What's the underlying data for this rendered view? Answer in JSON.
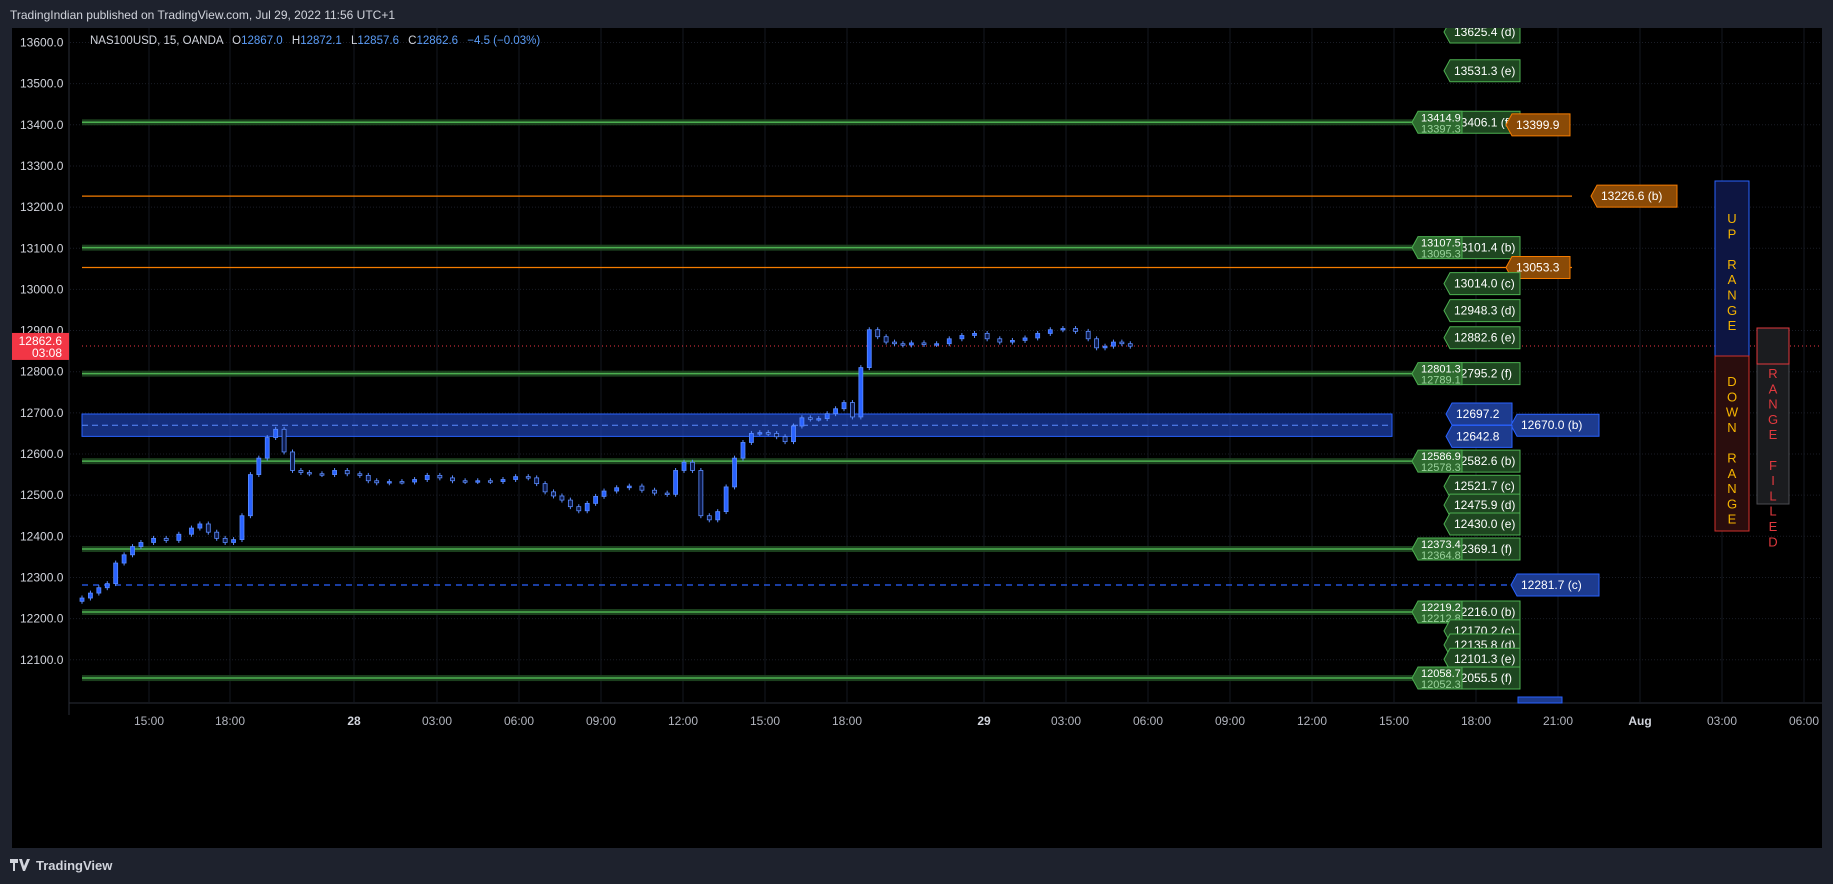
{
  "header": {
    "publisher": "TradingIndian published on TradingView.com, Jul 29, 2022 11:56 UTC+1"
  },
  "legend": {
    "symbol": "NAS100USD, 15, OANDA",
    "open_label": "O",
    "open": "12867.0",
    "high_label": "H",
    "high": "12872.1",
    "low_label": "L",
    "low": "12857.6",
    "close_label": "C",
    "close": "12862.6",
    "change": "−4.5 (−0.03%)"
  },
  "footer": {
    "brand": "TradingView"
  },
  "colors": {
    "background": "#000000",
    "candle": "#2962ff",
    "green_level": "#4caf50",
    "orange_level": "#f57c00",
    "blue_zone": "#2962ff",
    "current_price": "#f23645"
  },
  "chart_data": {
    "type": "candlestick",
    "symbol": "NAS100USD",
    "interval": "15",
    "ylim": [
      12030,
      13640
    ],
    "y_ticks": [
      "13600.0",
      "13500.0",
      "13400.0",
      "13300.0",
      "13200.0",
      "13100.0",
      "13000.0",
      "12900.0",
      "12800.0",
      "12700.0",
      "12600.0",
      "12500.0",
      "12400.0",
      "12300.0",
      "12200.0",
      "12100.0"
    ],
    "x_ticks": [
      "15:00",
      "18:00",
      "28",
      "03:00",
      "06:00",
      "09:00",
      "12:00",
      "15:00",
      "18:00",
      "29",
      "03:00",
      "06:00",
      "09:00",
      "12:00",
      "15:00",
      "18:00",
      "21:00",
      "Aug",
      "03:00",
      "06:00"
    ],
    "current_price": {
      "value": 12862.6,
      "label": "12862.6",
      "countdown": "03:08"
    },
    "price_series": [
      [
        0,
        12250
      ],
      [
        2,
        12262
      ],
      [
        4,
        12275
      ],
      [
        6,
        12285
      ],
      [
        8,
        12335
      ],
      [
        10,
        12355
      ],
      [
        12,
        12375
      ],
      [
        14,
        12385
      ],
      [
        17,
        12395
      ],
      [
        20,
        12390
      ],
      [
        23,
        12405
      ],
      [
        26,
        12420
      ],
      [
        28,
        12430
      ],
      [
        30,
        12410
      ],
      [
        32,
        12395
      ],
      [
        34,
        12385
      ],
      [
        36,
        12392
      ],
      [
        38,
        12450
      ],
      [
        40,
        12550
      ],
      [
        42,
        12590
      ],
      [
        44,
        12640
      ],
      [
        46,
        12660
      ],
      [
        48,
        12605
      ],
      [
        50,
        12560
      ],
      [
        52,
        12555
      ],
      [
        54,
        12552
      ],
      [
        57,
        12550
      ],
      [
        60,
        12560
      ],
      [
        63,
        12552
      ],
      [
        66,
        12548
      ],
      [
        68,
        12535
      ],
      [
        70,
        12530
      ],
      [
        73,
        12533
      ],
      [
        76,
        12532
      ],
      [
        79,
        12538
      ],
      [
        82,
        12548
      ],
      [
        85,
        12542
      ],
      [
        88,
        12535
      ],
      [
        91,
        12533
      ],
      [
        94,
        12535
      ],
      [
        97,
        12533
      ],
      [
        100,
        12538
      ],
      [
        103,
        12545
      ],
      [
        106,
        12542
      ],
      [
        108,
        12528
      ],
      [
        110,
        12508
      ],
      [
        112,
        12498
      ],
      [
        114,
        12488
      ],
      [
        116,
        12472
      ],
      [
        118,
        12462
      ],
      [
        120,
        12480
      ],
      [
        122,
        12497
      ],
      [
        124,
        12510
      ],
      [
        127,
        12518
      ],
      [
        130,
        12522
      ],
      [
        133,
        12512
      ],
      [
        136,
        12505
      ],
      [
        139,
        12502
      ],
      [
        141,
        12560
      ],
      [
        143,
        12580
      ],
      [
        145,
        12560
      ],
      [
        147,
        12450
      ],
      [
        149,
        12440
      ],
      [
        151,
        12460
      ],
      [
        153,
        12520
      ],
      [
        155,
        12590
      ],
      [
        157,
        12628
      ],
      [
        159,
        12650
      ],
      [
        161,
        12652
      ],
      [
        163,
        12650
      ],
      [
        165,
        12642
      ],
      [
        167,
        12630
      ],
      [
        169,
        12668
      ],
      [
        171,
        12688
      ],
      [
        173,
        12685
      ],
      [
        175,
        12686
      ],
      [
        177,
        12698
      ],
      [
        179,
        12710
      ],
      [
        181,
        12725
      ],
      [
        183,
        12690
      ],
      [
        185,
        12810
      ],
      [
        187,
        12902
      ],
      [
        189,
        12885
      ],
      [
        191,
        12872
      ],
      [
        193,
        12868
      ],
      [
        195,
        12865
      ],
      [
        197,
        12870
      ],
      [
        200,
        12866
      ],
      [
        203,
        12868
      ],
      [
        206,
        12880
      ],
      [
        209,
        12888
      ],
      [
        212,
        12893
      ],
      [
        215,
        12880
      ],
      [
        218,
        12872
      ],
      [
        221,
        12876
      ],
      [
        224,
        12882
      ],
      [
        227,
        12893
      ],
      [
        230,
        12902
      ],
      [
        233,
        12905
      ],
      [
        236,
        12898
      ],
      [
        239,
        12880
      ],
      [
        241,
        12858
      ],
      [
        243,
        12862
      ],
      [
        245,
        12872
      ],
      [
        247,
        12868
      ],
      [
        249,
        12862
      ]
    ],
    "blue_zone": {
      "top": 12697.2,
      "bottom": 12642.8,
      "mid": 12670.0
    },
    "levels": [
      {
        "value": 13625.4,
        "label": "13625.4 (d)",
        "color": "green",
        "line": false
      },
      {
        "value": 13531.3,
        "label": "13531.3 (e)",
        "color": "green",
        "line": false
      },
      {
        "value": 13406.1,
        "label": "13406.1 (f)",
        "color": "green",
        "line": true,
        "extra": [
          "13414.9",
          "13397.3"
        ]
      },
      {
        "value": 13399.9,
        "label": "13399.9",
        "color": "orange",
        "line": false
      },
      {
        "value": 13226.6,
        "label": "13226.6 (b)",
        "color": "orange",
        "line": true
      },
      {
        "value": 13101.4,
        "label": "13101.4 (b)",
        "color": "green",
        "line": true,
        "extra": [
          "13107.5",
          "13095.3"
        ]
      },
      {
        "value": 13053.3,
        "label": "13053.3",
        "color": "orange",
        "line": true
      },
      {
        "value": 13014.0,
        "label": "13014.0 (c)",
        "color": "green",
        "line": false
      },
      {
        "value": 12948.3,
        "label": "12948.3 (d)",
        "color": "green",
        "line": false
      },
      {
        "value": 12882.6,
        "label": "12882.6 (e)",
        "color": "green",
        "line": false
      },
      {
        "value": 12795.2,
        "label": "12795.2 (f)",
        "color": "green",
        "line": true,
        "extra": [
          "12801.3",
          "12789.1"
        ]
      },
      {
        "value": 12697.2,
        "label": "12697.2",
        "color": "blue",
        "line": false
      },
      {
        "value": 12670.0,
        "label": "12670.0 (b)",
        "color": "blue",
        "line": false
      },
      {
        "value": 12642.8,
        "label": "12642.8",
        "color": "blue",
        "line": false
      },
      {
        "value": 12582.6,
        "label": "12582.6 (b)",
        "color": "green",
        "line": true,
        "extra": [
          "12586.9",
          "12578.3"
        ]
      },
      {
        "value": 12521.7,
        "label": "12521.7 (c)",
        "color": "green",
        "line": false
      },
      {
        "value": 12475.9,
        "label": "12475.9 (d)",
        "color": "green",
        "line": false
      },
      {
        "value": 12430.0,
        "label": "12430.0 (e)",
        "color": "green",
        "line": false
      },
      {
        "value": 12369.1,
        "label": "12369.1 (f)",
        "color": "green",
        "line": true,
        "extra": [
          "12373.4",
          "12364.8"
        ]
      },
      {
        "value": 12281.7,
        "label": "12281.7 (c)",
        "color": "blue",
        "line": true,
        "dashed": true
      },
      {
        "value": 12216.0,
        "label": "12216.0 (b)",
        "color": "green",
        "line": true,
        "extra": [
          "12219.2",
          "12212.8"
        ]
      },
      {
        "value": 12170.2,
        "label": "12170.2 (c)",
        "color": "green",
        "line": false
      },
      {
        "value": 12135.8,
        "label": "12135.8 (d)",
        "color": "green",
        "line": false
      },
      {
        "value": 12101.3,
        "label": "12101.3 (e)",
        "color": "green",
        "line": false
      },
      {
        "value": 12055.5,
        "label": "12055.5 (f)",
        "color": "green",
        "line": true,
        "extra": [
          "12058.7",
          "12052.3"
        ]
      }
    ],
    "range_panels": {
      "up": {
        "letters": [
          "U",
          "P",
          "",
          "R",
          "A",
          "N",
          "G",
          "E"
        ]
      },
      "down": {
        "letters": [
          "D",
          "O",
          "W",
          "N",
          "",
          "R",
          "A",
          "N",
          "G",
          "E"
        ]
      },
      "filled": {
        "letters": [
          "R",
          "A",
          "N",
          "G",
          "E",
          "",
          "F",
          "I",
          "L",
          "L",
          "E",
          "D"
        ]
      }
    }
  }
}
